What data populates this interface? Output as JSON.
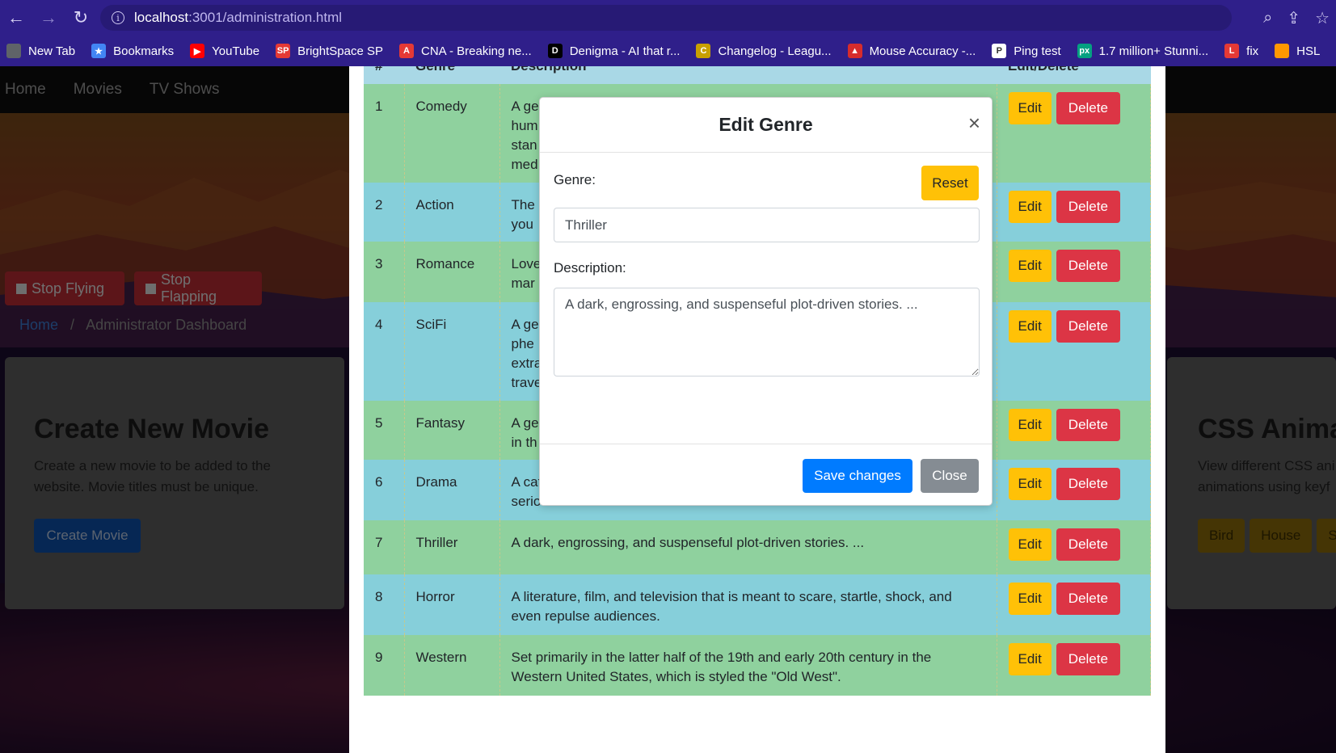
{
  "browser": {
    "url_host": "localhost",
    "url_path": ":3001/administration.html",
    "bookmarks": [
      {
        "label": "New Tab",
        "color": "#5f6368",
        "glyph": ""
      },
      {
        "label": "Bookmarks",
        "color": "#4285f4",
        "glyph": "★"
      },
      {
        "label": "YouTube",
        "color": "#ff0000",
        "glyph": "▶"
      },
      {
        "label": "BrightSpace SP",
        "color": "#e53935",
        "glyph": "SP"
      },
      {
        "label": "CNA - Breaking ne...",
        "color": "#e53935",
        "glyph": "A"
      },
      {
        "label": "Denigma - AI that r...",
        "color": "#000000",
        "glyph": "D"
      },
      {
        "label": "Changelog - Leagu...",
        "color": "#c8a000",
        "glyph": "C"
      },
      {
        "label": "Mouse Accuracy -...",
        "color": "#d62c2c",
        "glyph": "▲"
      },
      {
        "label": "Ping test",
        "color": "#ffffff",
        "glyph": "P"
      },
      {
        "label": "1.7 million+ Stunni...",
        "color": "#05a081",
        "glyph": "px"
      },
      {
        "label": "fix",
        "color": "#e53935",
        "glyph": "L"
      },
      {
        "label": "HSL",
        "color": "#ff9800",
        "glyph": ""
      }
    ]
  },
  "nav": {
    "items": [
      "Home",
      "Movies",
      "TV Shows"
    ]
  },
  "buttons": {
    "stop_flying": "Stop Flying",
    "stop_flapping": "Stop Flapping"
  },
  "breadcrumb": {
    "home": "Home",
    "sep": "/",
    "current": "Administrator Dashboard"
  },
  "left_card": {
    "title": "Create New Movie",
    "text": "Create a new movie to be added to the website. Movie titles must be unique.",
    "button": "Create Movie"
  },
  "right_card": {
    "title": "CSS Anima",
    "text": "View different CSS ani animations using keyf",
    "buttons": [
      "Bird",
      "House",
      "S"
    ]
  },
  "table": {
    "headers": [
      "#",
      "Genre",
      "Description",
      "Edit/Delete"
    ],
    "edit_label": "Edit",
    "delete_label": "Delete",
    "rows": [
      {
        "num": "1",
        "genre": "Comedy",
        "desc_lines": [
          "A ge",
          "hum",
          "stan",
          "med"
        ],
        "tone": "g"
      },
      {
        "num": "2",
        "genre": "Action",
        "desc_lines": [
          "The",
          "you"
        ],
        "tone": "b"
      },
      {
        "num": "3",
        "genre": "Romance",
        "desc_lines": [
          "Love",
          "mar"
        ],
        "tone": "g"
      },
      {
        "num": "4",
        "genre": "SciFi",
        "desc_lines": [
          "A ge",
          "phe",
          "extra",
          "trave"
        ],
        "tone": "b"
      },
      {
        "num": "5",
        "genre": "Fantasy",
        "desc_lines": [
          "A ge",
          "in th"
        ],
        "tone": "g"
      },
      {
        "num": "6",
        "genre": "Drama",
        "desc_lines": [
          "A category of narrative fiction (or semi-fiction) intended to be more",
          "serious than humorous in tone."
        ],
        "tone": "b"
      },
      {
        "num": "7",
        "genre": "Thriller",
        "desc_lines": [
          "A dark, engrossing, and suspenseful plot-driven stories. ..."
        ],
        "tone": "g"
      },
      {
        "num": "8",
        "genre": "Horror",
        "desc_lines": [
          "A literature, film, and television that is meant to scare, startle, shock, and",
          "even repulse audiences."
        ],
        "tone": "b"
      },
      {
        "num": "9",
        "genre": "Western",
        "desc_lines": [
          "Set primarily in the latter half of the 19th and early 20th century in the",
          "Western United States, which is styled the \"Old West\"."
        ],
        "tone": "g"
      }
    ]
  },
  "modal": {
    "title": "Edit Genre",
    "close_glyph": "×",
    "genre_label": "Genre:",
    "reset_label": "Reset",
    "genre_value": "Thriller",
    "description_label": "Description:",
    "description_value": "A dark, engrossing, and suspenseful plot-driven stories. ...",
    "save_label": "Save changes",
    "close_label": "Close"
  }
}
